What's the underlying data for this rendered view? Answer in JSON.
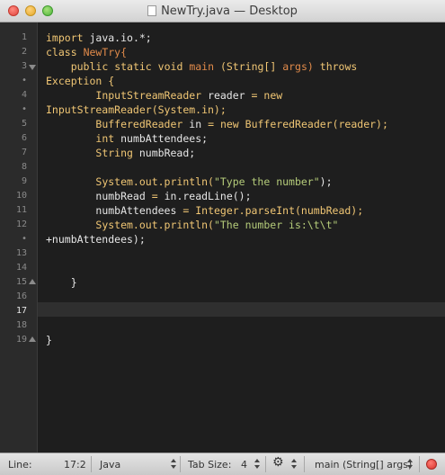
{
  "window": {
    "title": "NewTry.java — Desktop"
  },
  "gutter": {
    "lines": [
      "1",
      "2",
      "3",
      "•",
      "4",
      "•",
      "5",
      "6",
      "7",
      "8",
      "9",
      "10",
      "11",
      "12",
      "•",
      "13",
      "14",
      "15",
      "16",
      "17",
      "18",
      "19"
    ],
    "current_line": "17"
  },
  "code": {
    "l1": [
      "import",
      "java.io.*;"
    ],
    "l2": [
      "class",
      "NewTry{"
    ],
    "l3": [
      "public",
      "static",
      "void",
      "main",
      "(String[]",
      "args)",
      "throws"
    ],
    "l3b": "Exception {",
    "l4": [
      "InputStreamReader",
      "reader",
      "=",
      "new"
    ],
    "l4b": [
      "InputStreamReader(System.in);"
    ],
    "l5": [
      "BufferedReader",
      "in",
      "=",
      "new",
      "BufferedReader(reader);"
    ],
    "l6": [
      "int",
      "numbAttendees;"
    ],
    "l7": [
      "String",
      "numbRead;"
    ],
    "l9": [
      "System.out.println(",
      "\"Type the number\"",
      ");"
    ],
    "l10": [
      "numbRead",
      "=",
      "in.readLine();"
    ],
    "l11": [
      "numbAttendees",
      "=",
      "Integer.parseInt(numbRead);"
    ],
    "l12": [
      "System.out.println(",
      "\"The number is:\\t\\t\""
    ],
    "l12b": "+numbAttendees);",
    "l15": "}",
    "l19": "}"
  },
  "status": {
    "line_label": "Line:",
    "line_value": "17:2",
    "language": "Java",
    "tab_size_label": "Tab Size:",
    "tab_size_value": "4",
    "symbol": "main (String[] args)"
  },
  "colors": {
    "keyword": "#f0c674",
    "class_name": "#e08a4a",
    "string": "#b5cc7a",
    "background": "#1e1e1e"
  }
}
